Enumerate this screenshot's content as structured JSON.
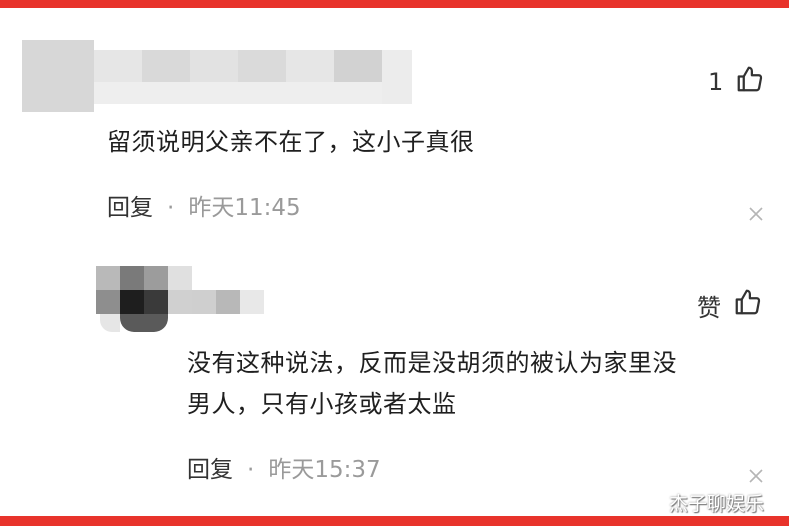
{
  "comments": [
    {
      "like_count": "1",
      "body": "留须说明父亲不在了，这小子真很",
      "reply_label": "回复",
      "separator": "·",
      "time": "昨天11:45"
    },
    {
      "like_count": "赞",
      "body_line1": "没有这种说法，反而是没胡须的被认为家里没",
      "body_line2": "男人，只有小孩或者太监",
      "reply_label": "回复",
      "separator": "·",
      "time": "昨天15:37"
    }
  ],
  "watermark": "杰子聊娱乐",
  "colors": {
    "frame": "#e8332b",
    "meta": "#9a9a9a",
    "text": "#1f1f1f"
  },
  "icons": {
    "like": "thumbs-up-icon",
    "close": "close-icon"
  }
}
